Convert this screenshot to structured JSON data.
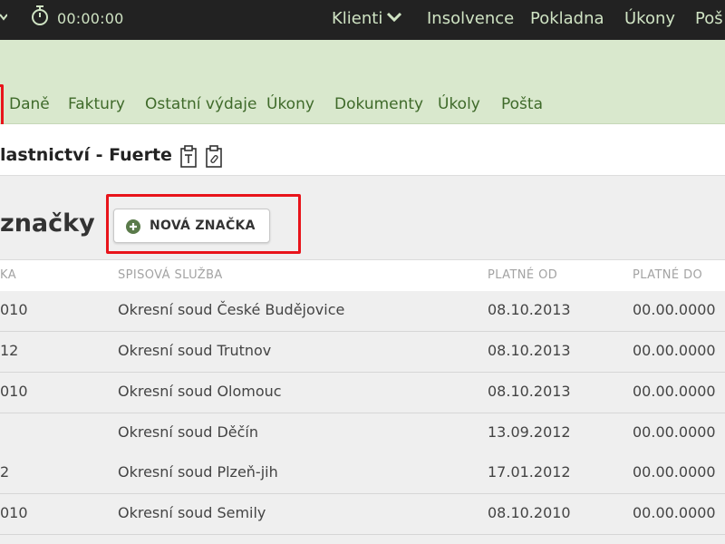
{
  "topbar": {
    "timer": "00:00:00",
    "nav": [
      {
        "label": "Klienti",
        "has_dropdown": true
      },
      {
        "label": "Insolvence"
      },
      {
        "label": "Pokladna"
      },
      {
        "label": "Úkony"
      },
      {
        "label": "Poš"
      }
    ]
  },
  "tabs": [
    {
      "label": "Daně"
    },
    {
      "label": "Faktury"
    },
    {
      "label": "Ostatní výdaje"
    },
    {
      "label": "Úkony"
    },
    {
      "label": "Dokumenty"
    },
    {
      "label": "Úkoly"
    },
    {
      "label": "Pošta"
    }
  ],
  "case_title": "lastnictví - Fuerte",
  "section": {
    "title": "značky",
    "new_button": "NOVÁ ZNAČKA"
  },
  "table": {
    "headers": [
      "KA",
      "SPISOVÁ SLUŽBA",
      "PLATNÉ OD",
      "PLATNÉ DO"
    ],
    "rows": [
      [
        "010",
        "Okresní soud České Budějovice",
        "08.10.2013",
        "00.00.0000"
      ],
      [
        "12",
        "Okresní soud Trutnov",
        "08.10.2013",
        "00.00.0000"
      ],
      [
        "010",
        "Okresní soud Olomouc",
        "08.10.2013",
        "00.00.0000"
      ],
      [
        "",
        "Okresní soud Děčín",
        "13.09.2012",
        "00.00.0000"
      ],
      [
        "2",
        "Okresní soud Plzeň-jih",
        "17.01.2012",
        "00.00.0000"
      ],
      [
        "010",
        "Okresní soud Semily",
        "08.10.2010",
        "00.00.0000"
      ]
    ]
  },
  "colors": {
    "topbar_bg": "#222222",
    "topbar_text": "#cfe3c3",
    "green_band": "#d9e8cd",
    "tab_text": "#3f6a2a",
    "highlight_red": "#e8141b",
    "plus_icon": "#5a7a4a"
  }
}
